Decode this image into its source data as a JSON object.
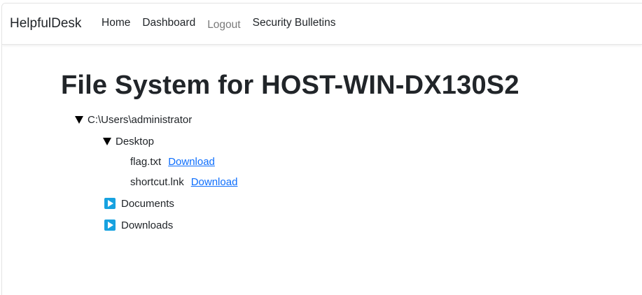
{
  "navbar": {
    "brand": "HelpfulDesk",
    "links": [
      {
        "label": "Home"
      },
      {
        "label": "Dashboard"
      },
      {
        "label": "Logout"
      },
      {
        "label": "Security Bulletins"
      }
    ]
  },
  "page": {
    "title": "File System for HOST-WIN-DX130S2"
  },
  "tree": {
    "root": {
      "label": "C:\\Users\\administrator",
      "expanded": true
    },
    "desktop": {
      "label": "Desktop",
      "expanded": true,
      "files": [
        {
          "name": "flag.txt",
          "action": " Download"
        },
        {
          "name": "shortcut.lnk",
          "action": " Download"
        }
      ]
    },
    "folders": [
      {
        "label": "Documents",
        "icon": "play-icon",
        "expanded": false
      },
      {
        "label": "Downloads",
        "icon": "play-icon",
        "expanded": false
      }
    ]
  },
  "colors": {
    "link": "#0d6efd",
    "folder_icon": "#17a2e0",
    "muted_nav": "#7a7a7a"
  }
}
